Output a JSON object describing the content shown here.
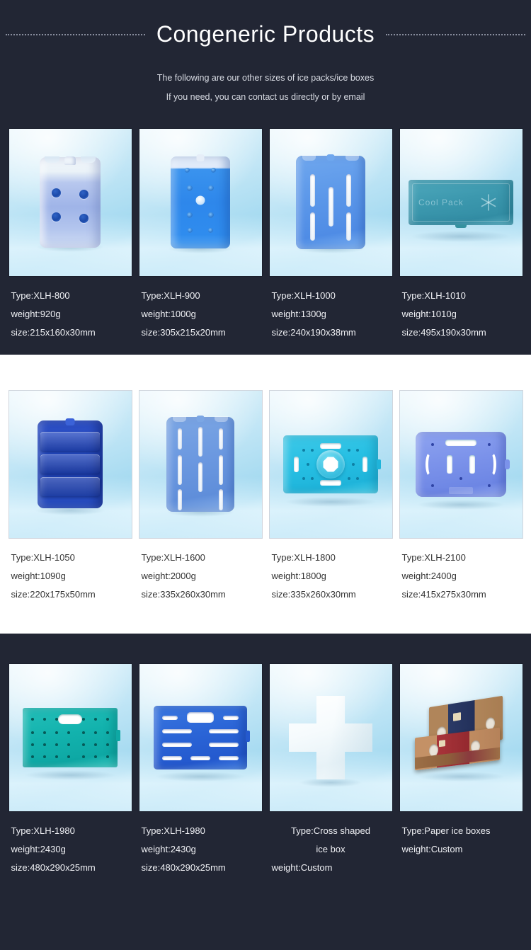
{
  "header": {
    "title": "Congeneric Products",
    "subtitle_line1": "The following are our other sizes of ice packs/ice boxes",
    "subtitle_line2": "If you need, you can contact us directly or by email"
  },
  "colors": {
    "dark_background": "#222634",
    "light_background": "#ffffff",
    "dark_text": "#ffffff",
    "light_text": "#333333"
  },
  "rows": [
    {
      "theme": "dark",
      "products": [
        {
          "type": "Type:XLH-800",
          "weight": "weight:920g",
          "size": "size:215x160x30mm",
          "art": "white-blue-brick-4-dimples"
        },
        {
          "type": "Type:XLH-900",
          "weight": "weight:1000g",
          "size": "size:305x215x20mm",
          "art": "blue-liquid-pack-dimples"
        },
        {
          "type": "Type:XLH-1000",
          "weight": "weight:1300g",
          "size": "size:240x190x38mm",
          "art": "blue-slotted-plate"
        },
        {
          "type": "Type:XLH-1010",
          "weight": "weight:1010g",
          "size": "size:495x190x30mm",
          "art": "teal-cool-pack-flat-box",
          "brand_text": "Cool Pack"
        }
      ]
    },
    {
      "theme": "light",
      "products": [
        {
          "type": "Type:XLH-1050",
          "weight": "weight:1090g",
          "size": "size:220x175x50mm",
          "art": "navy-ridged-brick"
        },
        {
          "type": "Type:XLH-1600",
          "weight": "weight:2000g",
          "size": "size:335x260x30mm",
          "art": "blue-multi-slot-plate"
        },
        {
          "type": "Type:XLH-1800",
          "weight": "weight:1800g",
          "size": "size:335x260x30mm",
          "art": "cyan-octagon-hole-plate"
        },
        {
          "type": "Type:XLH-2100",
          "weight": "weight:2400g",
          "size": "size:415x275x30mm",
          "art": "periwinkle-slot-arc-plate"
        }
      ]
    },
    {
      "theme": "dark",
      "products": [
        {
          "type": "Type:XLH-1980",
          "weight": "weight:2430g",
          "size": "size:480x290x25mm",
          "art": "teal-dotted-handle-plate"
        },
        {
          "type": "Type:XLH-1980",
          "weight": "weight:2430g",
          "size": "size:480x290x25mm",
          "art": "blue-dashed-handle-plate"
        },
        {
          "type": "Type:Cross shaped",
          "type_line2": "ice box",
          "weight": "weight:Custom",
          "size": "",
          "art": "white-cross-ice-box",
          "centered": true
        },
        {
          "type": "Type:Paper ice boxes",
          "weight": "weight:Custom",
          "size": "",
          "art": "paper-ice-boxes"
        }
      ]
    }
  ]
}
